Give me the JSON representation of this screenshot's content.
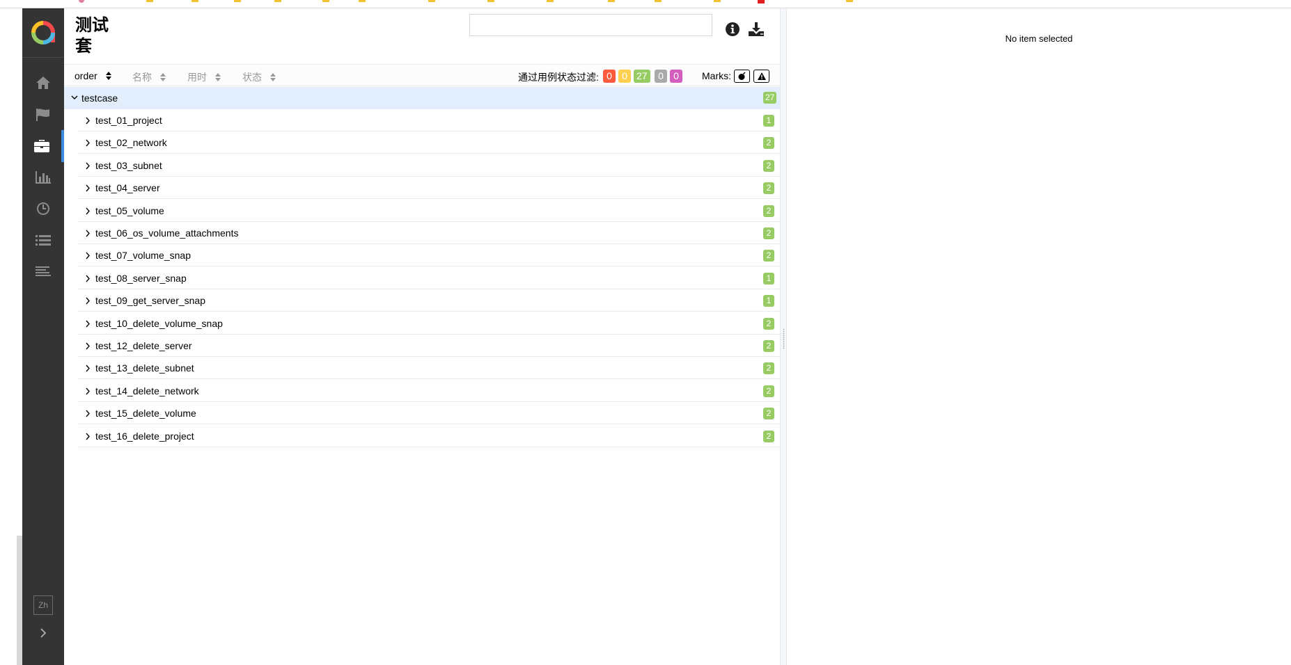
{
  "pane": {
    "title": "测试套",
    "search_placeholder": ""
  },
  "sorters": [
    {
      "label": "order",
      "active": true
    },
    {
      "label": "名称",
      "active": false
    },
    {
      "label": "用时",
      "active": false
    },
    {
      "label": "状态",
      "active": false
    }
  ],
  "filter": {
    "label": "通过用例状态过滤:",
    "badges": [
      {
        "status": "failed",
        "value": "0",
        "color": "#fd5a3e"
      },
      {
        "status": "broken",
        "value": "0",
        "color": "#ffd050"
      },
      {
        "status": "passed",
        "value": "27",
        "color": "#97cc64"
      },
      {
        "status": "skipped",
        "value": "0",
        "color": "#aaaaaa"
      },
      {
        "status": "unknown",
        "value": "0",
        "color": "#d35ebe"
      }
    ]
  },
  "marks": {
    "label": "Marks:",
    "items": [
      "flaky-icon",
      "new-failed-icon"
    ]
  },
  "tree": {
    "group": {
      "name": "testcase",
      "count": "27"
    },
    "suites": [
      {
        "name": "test_01_project",
        "count": "1"
      },
      {
        "name": "test_02_network",
        "count": "2"
      },
      {
        "name": "test_03_subnet",
        "count": "2"
      },
      {
        "name": "test_04_server",
        "count": "2"
      },
      {
        "name": "test_05_volume",
        "count": "2"
      },
      {
        "name": "test_06_os_volume_attachments",
        "count": "2"
      },
      {
        "name": "test_07_volume_snap",
        "count": "2"
      },
      {
        "name": "test_08_server_snap",
        "count": "1"
      },
      {
        "name": "test_09_get_server_snap",
        "count": "1"
      },
      {
        "name": "test_10_delete_volume_snap",
        "count": "2"
      },
      {
        "name": "test_12_delete_server",
        "count": "2"
      },
      {
        "name": "test_13_delete_subnet",
        "count": "2"
      },
      {
        "name": "test_14_delete_network",
        "count": "2"
      },
      {
        "name": "test_15_delete_volume",
        "count": "2"
      },
      {
        "name": "test_16_delete_project",
        "count": "2"
      }
    ]
  },
  "sidebar": {
    "items": [
      "home-icon",
      "flag-icon",
      "briefcase-icon",
      "bar-chart-icon",
      "clock-icon",
      "list-icon",
      "lines-icon"
    ],
    "active": "briefcase-icon",
    "language": "Zh"
  },
  "detail": {
    "empty_message": "No item selected"
  }
}
